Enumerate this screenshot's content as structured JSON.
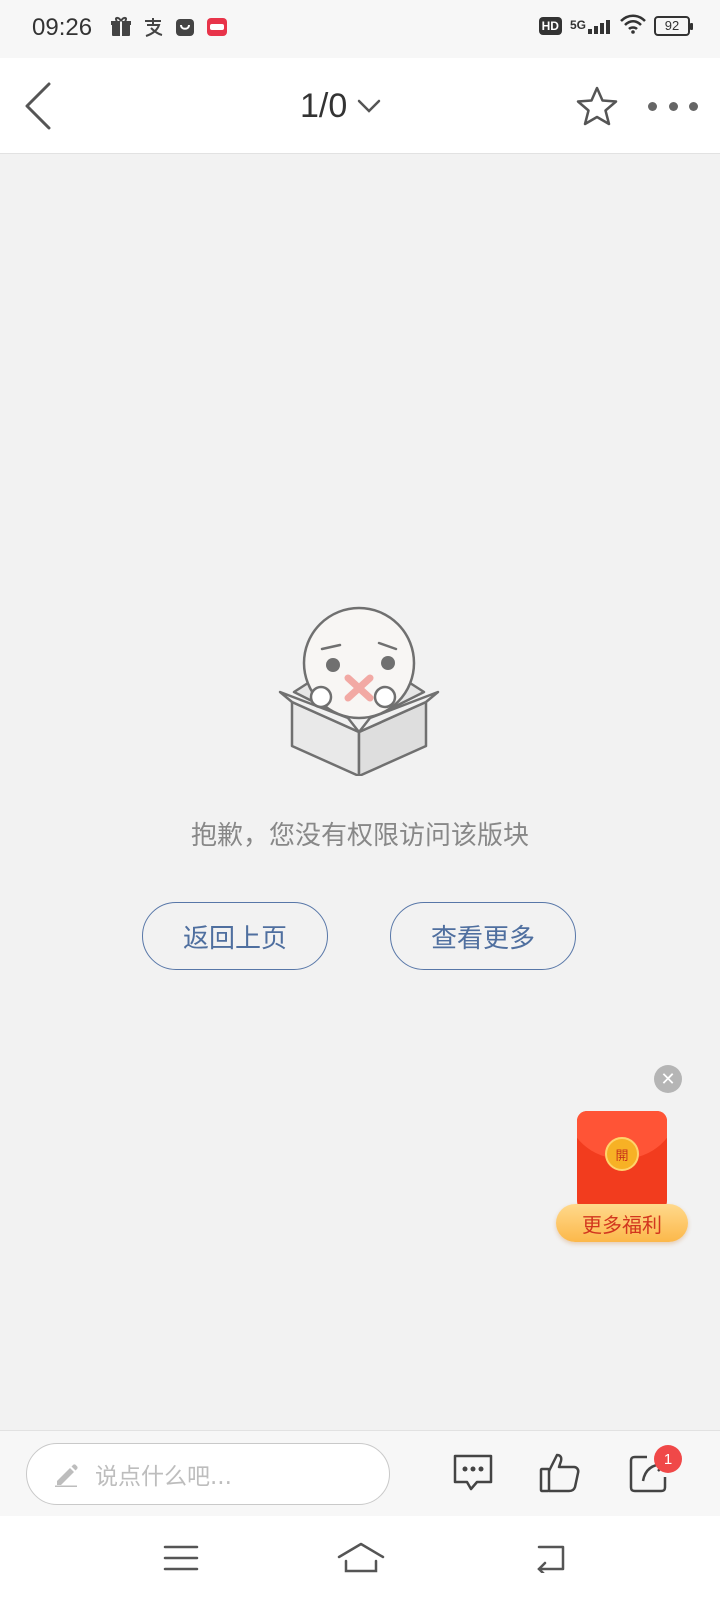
{
  "status_bar": {
    "time": "09:26",
    "network": "5G",
    "hd": "HD",
    "battery": "92",
    "app_icons": [
      "gift-icon",
      "alipay-icon",
      "shopping-bag-icon",
      "coupon-app-icon"
    ]
  },
  "header": {
    "pager": "1/0"
  },
  "main": {
    "message": "抱歉，您没有权限访问该版块",
    "back_button": "返回上页",
    "more_button": "查看更多"
  },
  "promo": {
    "coin_text": "開",
    "label": "更多福利",
    "close": "✕"
  },
  "comment_bar": {
    "placeholder": "说点什么吧...",
    "share_badge": "1"
  },
  "colors": {
    "accent": "#4f6f9f",
    "promo_red": "#f23c1e",
    "badge_red": "#f04848",
    "background": "#f2f2f2"
  }
}
